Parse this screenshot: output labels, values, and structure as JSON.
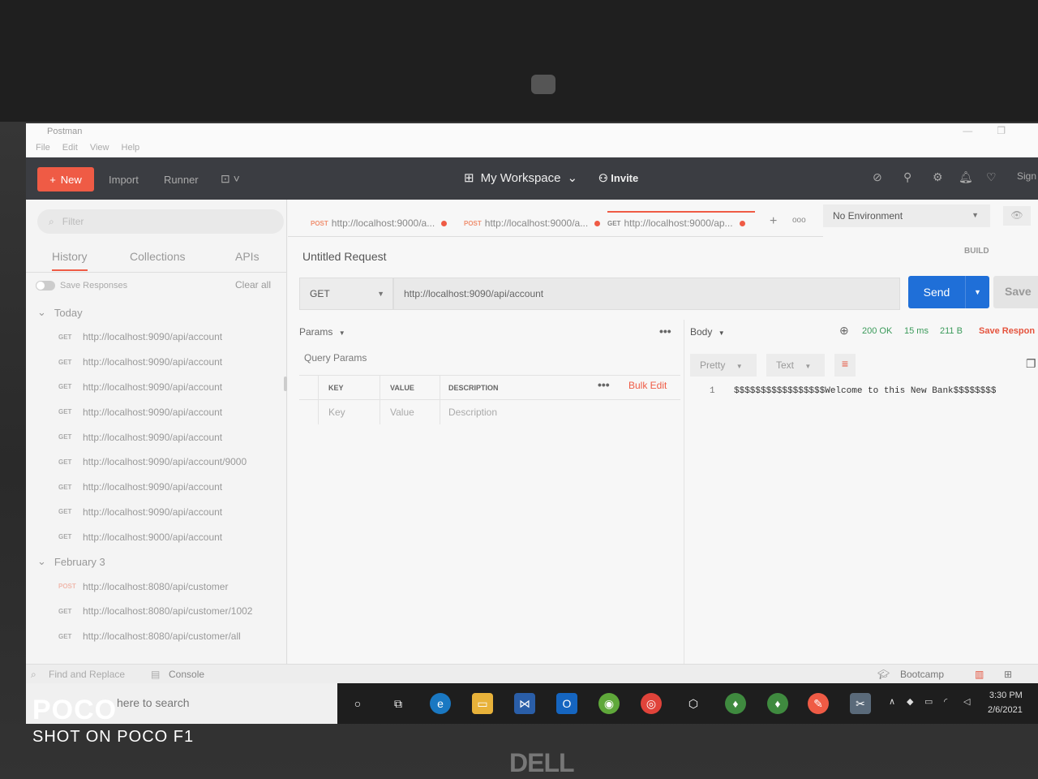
{
  "app": {
    "title": "Postman",
    "menu": [
      "File",
      "Edit",
      "View",
      "Help"
    ]
  },
  "header": {
    "new_label": "New",
    "import_label": "Import",
    "runner_label": "Runner",
    "workspace_label": "My Workspace",
    "invite_label": "Invite",
    "sign_label": "Sign"
  },
  "sidebar": {
    "filter_placeholder": "Filter",
    "tabs": [
      "History",
      "Collections",
      "APIs"
    ],
    "save_responses_label": "Save Responses",
    "clear_all_label": "Clear all",
    "groups": [
      {
        "title": "Today",
        "items": [
          {
            "method": "GET",
            "url": "http://localhost:9090/api/account"
          },
          {
            "method": "GET",
            "url": "http://localhost:9090/api/account"
          },
          {
            "method": "GET",
            "url": "http://localhost:9090/api/account"
          },
          {
            "method": "GET",
            "url": "http://localhost:9090/api/account"
          },
          {
            "method": "GET",
            "url": "http://localhost:9090/api/account"
          },
          {
            "method": "GET",
            "url": "http://localhost:9090/api/account/9000"
          },
          {
            "method": "GET",
            "url": "http://localhost:9090/api/account"
          },
          {
            "method": "GET",
            "url": "http://localhost:9090/api/account"
          },
          {
            "method": "GET",
            "url": "http://localhost:9000/api/account"
          }
        ]
      },
      {
        "title": "February 3",
        "items": [
          {
            "method": "POST",
            "url": "http://localhost:8080/api/customer"
          },
          {
            "method": "GET",
            "url": "http://localhost:8080/api/customer/1002"
          },
          {
            "method": "GET",
            "url": "http://localhost:8080/api/customer/all"
          }
        ]
      }
    ]
  },
  "request_tabs": [
    {
      "method": "POST",
      "url": "http://localhost:9000/a..."
    },
    {
      "method": "POST",
      "url": "http://localhost:9000/a..."
    },
    {
      "method": "GET",
      "url": "http://localhost:9000/ap..."
    }
  ],
  "environment": "No Environment",
  "request": {
    "title": "Untitled Request",
    "build_label": "BUILD",
    "method": "GET",
    "url": "http://localhost:9090/api/account",
    "send_label": "Send",
    "save_label": "Save",
    "params_label": "Params",
    "query_params_label": "Query Params",
    "columns": [
      "KEY",
      "VALUE",
      "DESCRIPTION"
    ],
    "bulk_edit_label": "Bulk Edit",
    "placeholders": [
      "Key",
      "Value",
      "Description"
    ]
  },
  "response": {
    "body_label": "Body",
    "status": "200 OK",
    "time": "15 ms",
    "size": "211 B",
    "save_response_label": "Save Respon",
    "format_pretty": "Pretty",
    "format_text": "Text",
    "line_number": "1",
    "body": "$$$$$$$$$$$$$$$$$Welcome to this New Bank$$$$$$$$"
  },
  "statusbar": {
    "find_replace": "Find and Replace",
    "console": "Console",
    "bootcamp": "Bootcamp"
  },
  "taskbar": {
    "search_placeholder": "here to search",
    "time": "3:30 PM",
    "date": "2/6/2021"
  },
  "watermark": {
    "brand": "POCO",
    "sub": "SHOT ON POCO F1"
  },
  "laptop_logo": "DELL"
}
